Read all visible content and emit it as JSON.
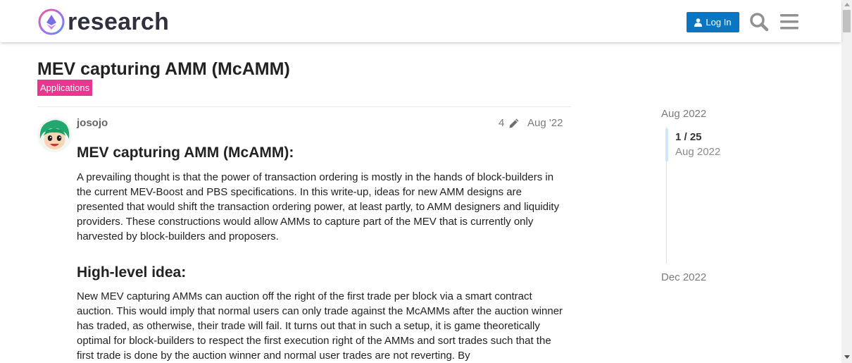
{
  "header": {
    "logo_text": "research",
    "login_label": "Log In",
    "accent_color": "#0a76c2"
  },
  "topic": {
    "title": "MEV capturing AMM (McAMM)",
    "category": "Applications",
    "category_color": "#e9368f"
  },
  "post": {
    "username": "josojo",
    "edit_count": "4",
    "date": "Aug '22",
    "heading1": "MEV capturing AMM (McAMM):",
    "paragraph1": "A prevailing thought is that the power of transaction ordering is mostly in the hands of block-builders in the current MEV-Boost and PBS specifications. In this write-up, ideas for new AMM designs are presented that would shift the transaction ordering power, at least partly, to AMM designers and liquidity providers. These constructions would allow AMMs to capture part of the MEV that is currently only harvested by block-builders and proposers.",
    "heading2": "High-level idea:",
    "paragraph2": "New MEV capturing AMMs can auction off the right of the first trade per block via a smart contract auction. This would imply that normal users can only trade against the McAMMs after the auction winner has traded, as otherwise, their trade will fail. It turns out that in such a setup, it is game theoretically optimal for block-builders to respect the first execution right of the AMMs and sort trades such that the first trade is done by the auction winner and normal user trades are not reverting. By"
  },
  "timeline": {
    "start_date": "Aug 2022",
    "position": "1 / 25",
    "position_date": "Aug 2022",
    "end_date": "Dec 2022"
  },
  "icons": [
    "logo-icon",
    "user-icon",
    "search-icon",
    "menu-icon",
    "pencil-icon",
    "avatar"
  ]
}
